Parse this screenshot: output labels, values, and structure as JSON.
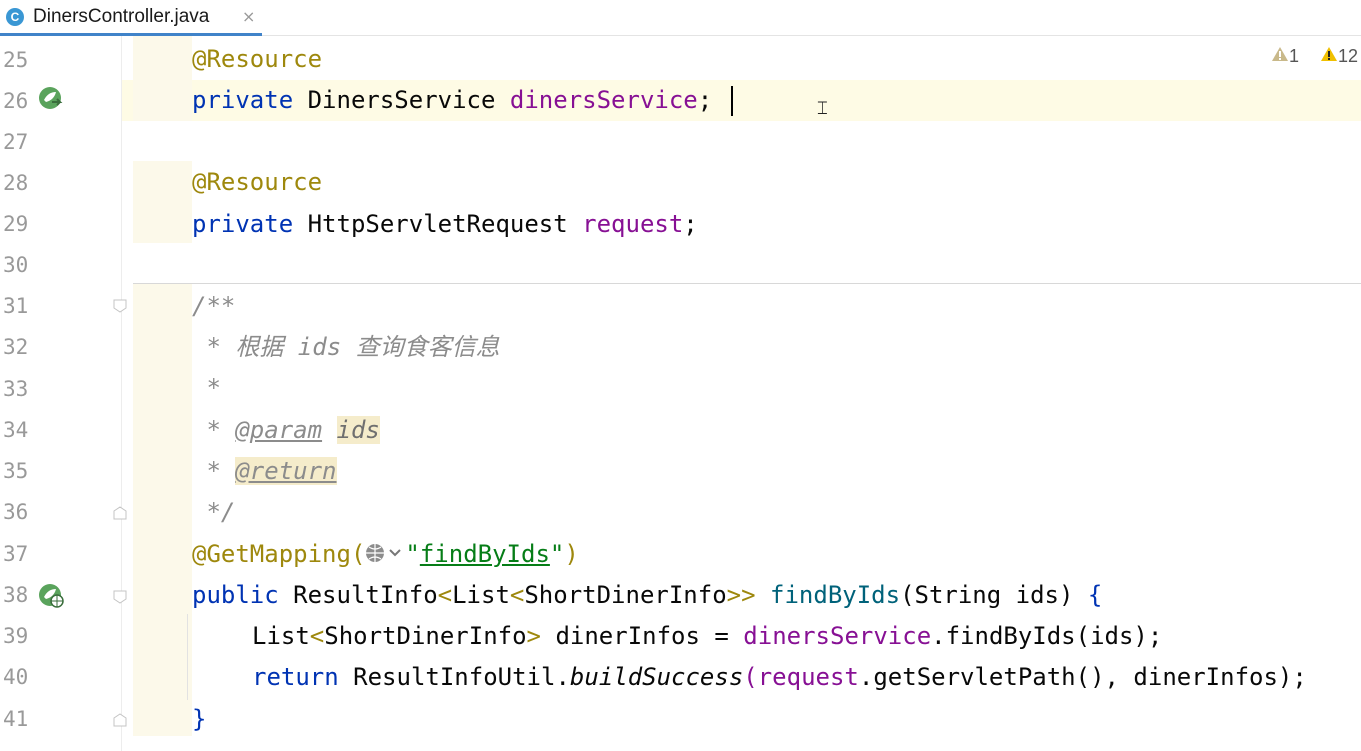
{
  "tab": {
    "icon_letter": "C",
    "title": "DinersController.java",
    "close_glyph": "×"
  },
  "inspections": {
    "weak_warning": "1",
    "warning": "12"
  },
  "lines": [
    {
      "num": "25"
    },
    {
      "num": "26"
    },
    {
      "num": "27"
    },
    {
      "num": "28"
    },
    {
      "num": "29"
    },
    {
      "num": "30"
    },
    {
      "num": "31"
    },
    {
      "num": "32"
    },
    {
      "num": "33"
    },
    {
      "num": "34"
    },
    {
      "num": "35"
    },
    {
      "num": "36"
    },
    {
      "num": "37"
    },
    {
      "num": "38"
    },
    {
      "num": "39"
    },
    {
      "num": "40"
    },
    {
      "num": "41"
    }
  ],
  "code": {
    "l25_ann": "@Resource",
    "l26_kw": "private",
    "l26_type": " DinersService ",
    "l26_field": "dinersService",
    "l26_end": ";",
    "l28_ann": "@Resource",
    "l29_kw": "private",
    "l29_type": " HttpServletRequest ",
    "l29_field": "request",
    "l29_end": ";",
    "l31": "/**",
    "l32_star": " * ",
    "l32_text": "根据 ids 查询食客信息",
    "l33": " *",
    "l34_star": " * ",
    "l34_tag": "@param",
    "l34_sp": " ",
    "l34_param": "ids",
    "l35_star": " * ",
    "l35_tag": "@return",
    "l36": " */",
    "l37_ann": "@GetMapping(",
    "l37_quote1": "\"",
    "l37_str": "findByIds",
    "l37_quote2": "\"",
    "l37_close": ")",
    "l38_kw": "public",
    "l38_type": " ResultInfo",
    "l38_g1": "<",
    "l38_t2": "List",
    "l38_g2": "<",
    "l38_t3": "ShortDinerInfo",
    "l38_g3": ">>",
    "l38_sp": " ",
    "l38_fn": "findByIds",
    "l38_params": "(String ids)",
    "l38_brace": " {",
    "l39_t": "List",
    "l39_g1": "<",
    "l39_t2": "ShortDinerInfo",
    "l39_g2": ">",
    "l39_rest": " dinerInfos = ",
    "l39_field": "dinersService",
    "l39_call": ".findByIds(ids);",
    "l40_kw": "return",
    "l40_cls": " ResultInfoUtil.",
    "l40_static": "buildSuccess",
    "l40_p1": "(",
    "l40_field": "request",
    "l40_call": ".getServletPath(), dinerInfos);",
    "l41": "}"
  },
  "colors": {
    "accent": "#4083c9",
    "keyword": "#0033b3",
    "annotation": "#9e880d",
    "field": "#871094",
    "comment": "#8c8c8c",
    "string": "#067d17",
    "caret_line": "#fefbe5"
  }
}
